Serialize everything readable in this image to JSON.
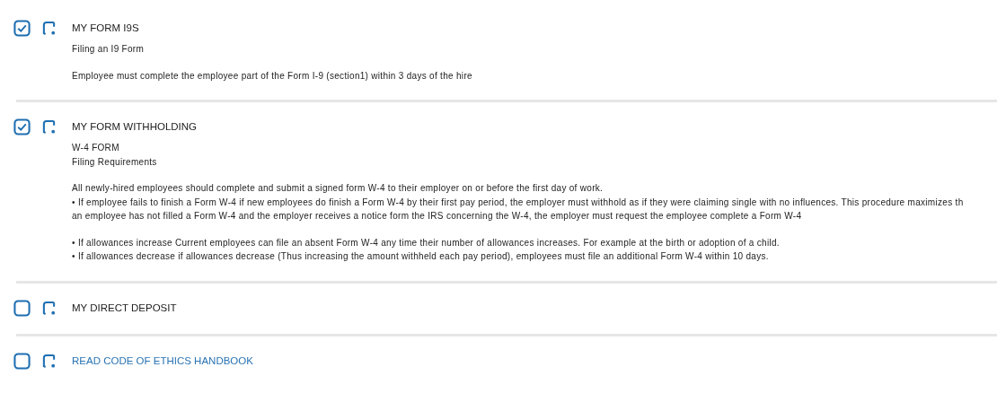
{
  "tasks": [
    {
      "kind": "task",
      "checked": true,
      "title": "MY FORM I9S",
      "paragraphs": [
        [
          "Filing an I9 Form"
        ],
        [
          "Employee must complete the employee part of the Form I-9 (section1) within 3 days of the hire"
        ]
      ]
    },
    {
      "kind": "task",
      "checked": true,
      "title": "MY FORM WITHHOLDING",
      "paragraphs": [
        [
          "W-4 FORM",
          "Filing Requirements"
        ],
        [
          "All newly-hired employees should complete and submit a signed form W-4 to their employer on or before the first day of work.",
          "•  If employee fails to finish a Form W-4 if new employees do finish a Form W-4 by their first pay period, the employer must withhold as if they were claiming single with no influences. This procedure maximizes th",
          "an employee has not filled a Form W-4 and the employer receives a notice form the IRS concerning the W-4, the employer must request the employee complete a Form W-4"
        ],
        [
          "•  If allowances increase Current employees can file an absent Form W-4 any time their number of allowances increases. For example at the birth or adoption of a child.",
          "•  If allowances decrease if allowances decrease (Thus increasing the amount withheld each pay period), employees must file an additional Form W-4 within 10 days."
        ]
      ]
    },
    {
      "kind": "task",
      "checked": false,
      "title": "MY DIRECT DEPOSIT"
    },
    {
      "kind": "link",
      "checked": false,
      "title": "READ CODE OF ETHICS HANDBOOK"
    }
  ]
}
